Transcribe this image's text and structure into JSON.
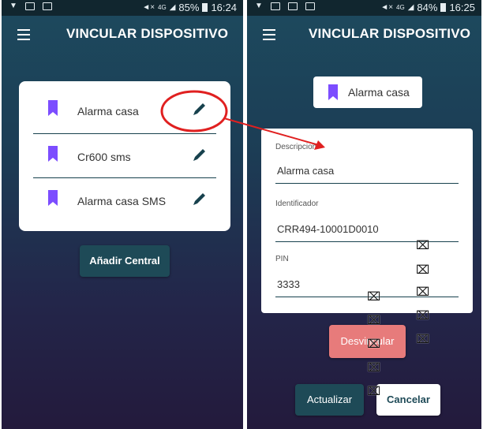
{
  "left_screen": {
    "status_bar": {
      "battery": "85%",
      "time": "16:24",
      "network": "4G"
    },
    "app_bar": {
      "title": "VINCULAR DISPOSITIVO"
    },
    "devices": [
      {
        "label": "Alarma casa",
        "icon": "bookmark-icon",
        "action_icon": "pencil-icon"
      },
      {
        "label": "Cr600 sms",
        "icon": "bookmark-icon",
        "action_icon": "pencil-icon"
      },
      {
        "label": "Alarma casa SMS",
        "icon": "bookmark-icon",
        "action_icon": "pencil-icon"
      }
    ],
    "add_button": "Añadir Central"
  },
  "right_screen": {
    "status_bar": {
      "battery": "84%",
      "time": "16:25",
      "network": "4G"
    },
    "app_bar": {
      "title": "VINCULAR DISPOSITIVO"
    },
    "selected_device": {
      "label": "Alarma casa",
      "icon": "bookmark-icon"
    },
    "form": {
      "description_label": "Descripcion",
      "description_value": "Alarma casa",
      "identifier_label": "Identificador",
      "identifier_value": "CRR494-10001D0010",
      "pin_label": "PIN",
      "pin_value": "3333"
    },
    "unlink_button": "Desvincular",
    "update_button": "Actualizar",
    "cancel_button": "Cancelar"
  },
  "overlay": {
    "mark_glyph": "⌧"
  },
  "colors": {
    "background_top": "#1d4a5e",
    "background_bottom": "#231a3c",
    "primary_button": "#1e4a57",
    "danger_button": "#e77b7b",
    "bookmark_icon": "#7c4dff",
    "annotation": "#e02020"
  }
}
